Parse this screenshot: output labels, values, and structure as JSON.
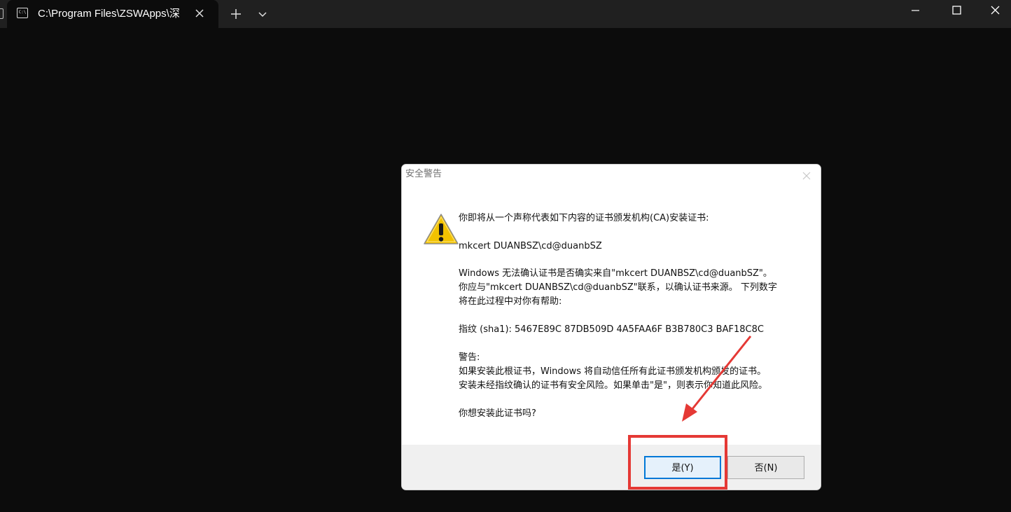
{
  "window": {
    "tab_title": "C:\\Program Files\\ZSWApps\\深",
    "tab_icon": "terminal-icon",
    "tab_icon_text": "C:\\",
    "new_tab_icon": "plus-icon",
    "dropdown_icon": "chevron-down-icon",
    "controls": [
      "minimize-icon",
      "maximize-icon",
      "close-icon"
    ]
  },
  "dialog": {
    "title": "安全警告",
    "icon": "warning-icon",
    "message": {
      "intro": "你即将从一个声称代表如下内容的证书颁发机构(CA)安装证书:",
      "issuer": "mkcert DUANBSZ\\cd@duanbSZ",
      "verify_line1": "Windows 无法确认证书是否确实来自\"mkcert DUANBSZ\\cd@duanbSZ\"。",
      "verify_line2": "你应与\"mkcert DUANBSZ\\cd@duanbSZ\"联系，以确认证书来源。 下列数字",
      "verify_line3": "将在此过程中对你有帮助:",
      "thumbprint": "指纹 (sha1): 5467E89C 87DB509D 4A5FAA6F B3B780C3 BAF18C8C",
      "warning_label": "警告:",
      "warning_line1": "如果安装此根证书，Windows 将自动信任所有此证书颁发机构颁发的证书。",
      "warning_line2": "安装未经指纹确认的证书有安全风险。如果单击\"是\"，则表示你知道此风险。",
      "question": "你想安装此证书吗?"
    },
    "buttons": {
      "yes": "是(Y)",
      "no": "否(N)"
    }
  },
  "colors": {
    "terminal_bg": "#0c0c0c",
    "titlebar_bg": "#202020",
    "annotation": "#e53935",
    "warning_yellow": "#f2c200"
  }
}
